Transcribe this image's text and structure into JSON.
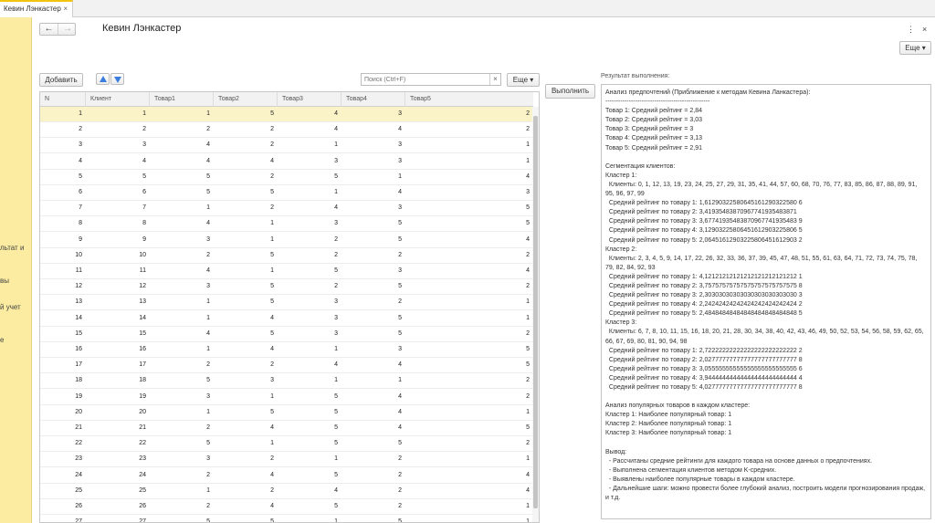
{
  "tab": {
    "title": "Кевин Лэнкастер",
    "close": "×"
  },
  "sidebar": {
    "items": [
      "льтат и",
      "вы",
      "й учет",
      "е"
    ]
  },
  "header": {
    "title": "Кевин Лэнкастер",
    "back": "←",
    "forward": "→",
    "more_icon": "⋮",
    "close_icon": "×",
    "more_button": "Еще ▾"
  },
  "toolbar": {
    "add": "Добавить",
    "search_placeholder": "Поиск (Ctrl+F)",
    "search_clear": "×",
    "more": "Еще ▾",
    "run": "Выполнить"
  },
  "table": {
    "columns": [
      "N",
      "Клиент",
      "Товар1",
      "Товар2",
      "Товар3",
      "Товар4",
      "Товар5"
    ],
    "rows": [
      [
        "1",
        "1",
        "1",
        "5",
        "4",
        "3",
        "2"
      ],
      [
        "2",
        "2",
        "2",
        "2",
        "4",
        "4",
        "2"
      ],
      [
        "3",
        "3",
        "4",
        "2",
        "1",
        "3",
        "1"
      ],
      [
        "4",
        "4",
        "4",
        "4",
        "3",
        "3",
        "1"
      ],
      [
        "5",
        "5",
        "5",
        "2",
        "5",
        "1",
        "4"
      ],
      [
        "6",
        "6",
        "5",
        "5",
        "1",
        "4",
        "3"
      ],
      [
        "7",
        "7",
        "1",
        "2",
        "4",
        "3",
        "5"
      ],
      [
        "8",
        "8",
        "4",
        "1",
        "3",
        "5",
        "5"
      ],
      [
        "9",
        "9",
        "3",
        "1",
        "2",
        "5",
        "4"
      ],
      [
        "10",
        "10",
        "2",
        "5",
        "2",
        "2",
        "2"
      ],
      [
        "11",
        "11",
        "4",
        "1",
        "5",
        "3",
        "4"
      ],
      [
        "12",
        "12",
        "3",
        "5",
        "2",
        "5",
        "2"
      ],
      [
        "13",
        "13",
        "1",
        "5",
        "3",
        "2",
        "1"
      ],
      [
        "14",
        "14",
        "1",
        "4",
        "3",
        "5",
        "1"
      ],
      [
        "15",
        "15",
        "4",
        "5",
        "3",
        "5",
        "2"
      ],
      [
        "16",
        "16",
        "1",
        "4",
        "1",
        "3",
        "5"
      ],
      [
        "17",
        "17",
        "2",
        "2",
        "4",
        "4",
        "5"
      ],
      [
        "18",
        "18",
        "5",
        "3",
        "1",
        "1",
        "2"
      ],
      [
        "19",
        "19",
        "3",
        "1",
        "5",
        "4",
        "2"
      ],
      [
        "20",
        "20",
        "1",
        "5",
        "5",
        "4",
        "1"
      ],
      [
        "21",
        "21",
        "2",
        "4",
        "5",
        "4",
        "5"
      ],
      [
        "22",
        "22",
        "5",
        "1",
        "5",
        "5",
        "2"
      ],
      [
        "23",
        "23",
        "3",
        "2",
        "1",
        "2",
        "1"
      ],
      [
        "24",
        "24",
        "2",
        "4",
        "5",
        "2",
        "4"
      ],
      [
        "25",
        "25",
        "1",
        "2",
        "4",
        "2",
        "4"
      ],
      [
        "26",
        "26",
        "2",
        "4",
        "5",
        "2",
        "1"
      ],
      [
        "27",
        "27",
        "5",
        "5",
        "1",
        "5",
        "1"
      ]
    ],
    "selected_row": 0
  },
  "result": {
    "label": "Результат выполнения:",
    "text": "Анализ предпочтений (Приближение к методам Кевина Ланкастера):\n-------------------------------------------------\nТовар 1: Средний рейтинг = 2,84\nТовар 2: Средний рейтинг = 3,03\nТовар 3: Средний рейтинг = 3\nТовар 4: Средний рейтинг = 3,13\nТовар 5: Средний рейтинг = 2,91\n\nСегментация клиентов:\nКластер 1:\n  Клиенты: 0, 1, 12, 13, 19, 23, 24, 25, 27, 29, 31, 35, 41, 44, 57, 60, 68, 70, 76, 77, 83, 85, 86, 87, 88, 89, 91, 95, 96, 97, 99\n  Средний рейтинг по товару 1: 1,61290322580645161290322580 6\n  Средний рейтинг по товару 2: 3,41935483870967741935483871\n  Средний рейтинг по товару 3: 3,67741935483870967741935483 9\n  Средний рейтинг по товару 4: 3,12903225806451612903225806 5\n  Средний рейтинг по товару 5: 2,06451612903225806451612903 2\nКластер 2:\n  Клиенты: 2, 3, 4, 5, 9, 14, 17, 22, 26, 32, 33, 36, 37, 39, 45, 47, 48, 51, 55, 61, 63, 64, 71, 72, 73, 74, 75, 78, 79, 82, 84, 92, 93\n  Средний рейтинг по товару 1: 4,12121212121212121212121212 1\n  Средний рейтинг по товару 2: 3,75757575757575757575757575 8\n  Средний рейтинг по товару 3: 2,30303030303030303030303030 3\n  Средний рейтинг по товару 4: 2,24242424242424242424242424 2\n  Средний рейтинг по товару 5: 2,48484848484848484848484848 5\nКластер 3:\n  Клиенты: 6, 7, 8, 10, 11, 15, 16, 18, 20, 21, 28, 30, 34, 38, 40, 42, 43, 46, 49, 50, 52, 53, 54, 56, 58, 59, 62, 65, 66, 67, 69, 80, 81, 90, 94, 98\n  Средний рейтинг по товару 1: 2,72222222222222222222222222 2\n  Средний рейтинг по товару 2: 2,02777777777777777777777777 8\n  Средний рейтинг по товару 3: 3,05555555555555555555555555 6\n  Средний рейтинг по товару 4: 3,94444444444444444444444444 4\n  Средний рейтинг по товару 5: 4,02777777777777777777777777 8\n\nАнализ популярных товаров в каждом кластере:\nКластер 1: Наиболее популярный товар: 1\nКластер 2: Наиболее популярный товар: 1\nКластер 3: Наиболее популярный товар: 1\n\nВывод:\n  - Рассчитаны средние рейтинги для каждого товара на основе данных о предпочтениях.\n  - Выполнена сегментация клиентов методом K-средних.\n  - Выявлены наиболее популярные товары в каждом кластере.\n  - Дальнейшие шаги: можно провести более глубокий анализ, построить модели прогнозирования продаж, и т.д."
  },
  "colors": {
    "accent": "#f1c40f",
    "sidebar": "#fbeca1",
    "selected_row": "#fbf3c8",
    "arrow": "#3b7ddd"
  },
  "icons": {
    "back": "arrow-left-icon",
    "forward": "arrow-right-icon",
    "up": "move-up-icon",
    "down": "move-down-icon"
  }
}
